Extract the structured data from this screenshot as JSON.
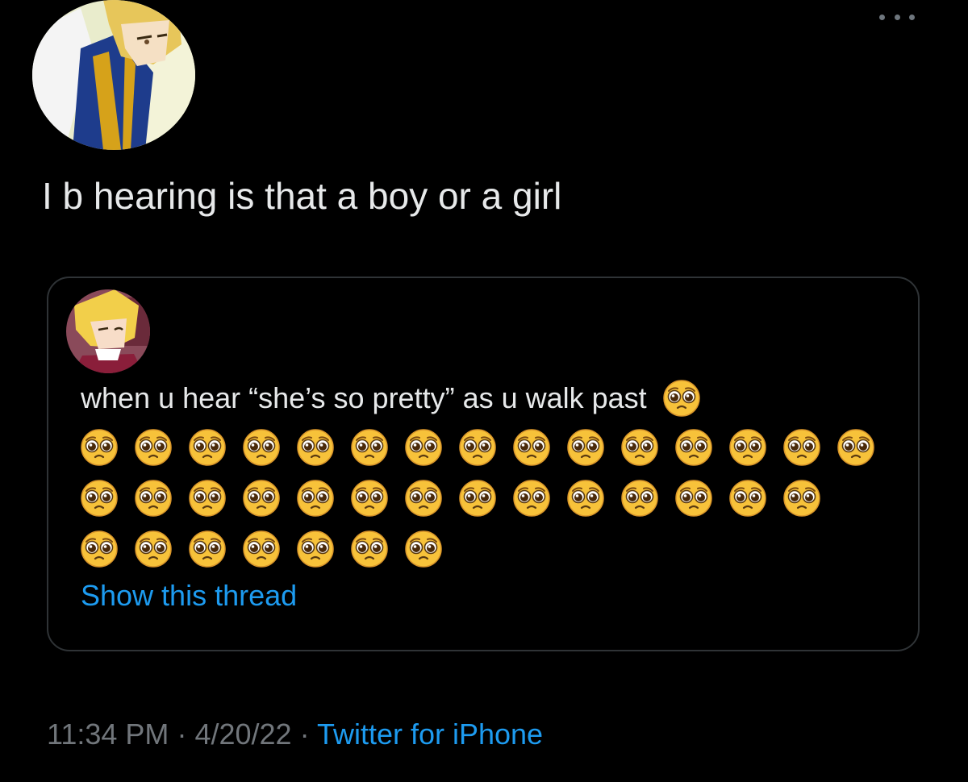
{
  "tweet": {
    "text": "I b hearing is that a boy or a girl",
    "avatar_icon": "anime-character-avatar",
    "more_icon": "more-options-icon"
  },
  "quote": {
    "text": "when u hear “she’s so pretty” as u walk past",
    "emoji_icon": "pleading-face-emoji",
    "emoji_count": 37,
    "emoji_rows": [
      1,
      15,
      14,
      7
    ],
    "show_thread": "Show this thread",
    "avatar_icon": "anime-character-avatar"
  },
  "meta": {
    "time": "11:34 PM",
    "sep1": "·",
    "date": "4/20/22",
    "sep2": "·",
    "source": "Twitter for iPhone"
  },
  "colors": {
    "background": "#000000",
    "text": "#e7e9ea",
    "muted": "#71767b",
    "link": "#1d9bf0",
    "border": "#2f3336"
  }
}
